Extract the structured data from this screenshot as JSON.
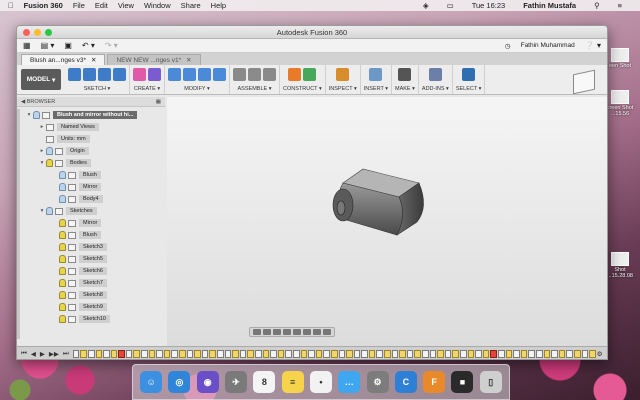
{
  "menubar": {
    "app": "Fusion 360",
    "items": [
      "File",
      "Edit",
      "View",
      "Window",
      "Share",
      "Help"
    ],
    "clock": "Tue 16:23",
    "user": "Fathin Mustafa"
  },
  "window": {
    "title": "Autodesk Fusion 360",
    "user": "Fathin Muhammad",
    "tabs": [
      "Blush an...nges v3*",
      "NEW NEW ...nges v1*"
    ]
  },
  "toolbar": {
    "workspace": "MODEL",
    "groups": [
      {
        "label": "SKETCH ▾",
        "colors": [
          "#3f7cc8",
          "#3f7cc8",
          "#3f7cc8",
          "#3f7cc8"
        ]
      },
      {
        "label": "CREATE ▾",
        "colors": [
          "#e05aa8",
          "#7c5bd0"
        ]
      },
      {
        "label": "MODIFY ▾",
        "colors": [
          "#4a8ad8",
          "#4a8ad8",
          "#4a8ad8",
          "#4a8ad8"
        ]
      },
      {
        "label": "ASSEMBLE ▾",
        "colors": [
          "#8a8a8a",
          "#8a8a8a",
          "#8a8a8a"
        ]
      },
      {
        "label": "CONSTRUCT ▾",
        "colors": [
          "#e87a2a",
          "#48a85a"
        ]
      },
      {
        "label": "INSPECT ▾",
        "colors": [
          "#d98c2c"
        ]
      },
      {
        "label": "INSERT ▾",
        "colors": [
          "#6b98c6"
        ]
      },
      {
        "label": "MAKE ▾",
        "colors": [
          "#555555"
        ]
      },
      {
        "label": "ADD-INS ▾",
        "colors": [
          "#6b7fa8"
        ]
      },
      {
        "label": "SELECT ▾",
        "colors": [
          "#2f6fb0"
        ]
      }
    ]
  },
  "browser": {
    "header": "BROWSER",
    "items": [
      {
        "label": "Blush and mirror without hi...",
        "indent": 0,
        "bulb": "blue",
        "tri": "▾",
        "top": true
      },
      {
        "label": "Named Views",
        "indent": 1,
        "bulb": "",
        "tri": "▸"
      },
      {
        "label": "Units: mm",
        "indent": 1,
        "bulb": "",
        "tri": ""
      },
      {
        "label": "Origin",
        "indent": 1,
        "bulb": "blue",
        "tri": "▸"
      },
      {
        "label": "Bodies",
        "indent": 1,
        "bulb": "yellow",
        "tri": "▾"
      },
      {
        "label": "Blush",
        "indent": 2,
        "bulb": "blue",
        "tri": ""
      },
      {
        "label": "Mirror",
        "indent": 2,
        "bulb": "blue",
        "tri": ""
      },
      {
        "label": "Body4",
        "indent": 2,
        "bulb": "blue",
        "tri": ""
      },
      {
        "label": "Sketches",
        "indent": 1,
        "bulb": "blue",
        "tri": "▾"
      },
      {
        "label": "Mirror",
        "indent": 2,
        "bulb": "yellow",
        "tri": ""
      },
      {
        "label": "Blush",
        "indent": 2,
        "bulb": "yellow",
        "tri": ""
      },
      {
        "label": "Sketch3",
        "indent": 2,
        "bulb": "yellow",
        "tri": ""
      },
      {
        "label": "Sketch5",
        "indent": 2,
        "bulb": "yellow",
        "tri": ""
      },
      {
        "label": "Sketch6",
        "indent": 2,
        "bulb": "yellow",
        "tri": ""
      },
      {
        "label": "Sketch7",
        "indent": 2,
        "bulb": "yellow",
        "tri": ""
      },
      {
        "label": "Sketch8",
        "indent": 2,
        "bulb": "yellow",
        "tri": ""
      },
      {
        "label": "Sketch9",
        "indent": 2,
        "bulb": "yellow",
        "tri": ""
      },
      {
        "label": "Sketch10",
        "indent": 2,
        "bulb": "yellow",
        "tri": ""
      }
    ]
  },
  "timeline": {
    "controls": [
      "⏮",
      "◀",
      "▶",
      "▶▶",
      "⏭"
    ],
    "items": "sysysyrsysysysysysyssysysysyssysysysyssysysysyssysysysyrsysyssysysysy"
  },
  "desktop": {
    "icons": [
      {
        "label": "een Shot"
      },
      {
        "label": "creen Shot ...15.56"
      },
      {
        "label": "Shot ...15.28.08"
      }
    ]
  },
  "dock": {
    "apps": [
      {
        "name": "finder",
        "glyph": "☺",
        "color": "#3d8fe0"
      },
      {
        "name": "safari",
        "glyph": "◎",
        "color": "#2f86d8"
      },
      {
        "name": "siri",
        "glyph": "◉",
        "color": "#6a4fc8"
      },
      {
        "name": "launchpad",
        "glyph": "✈",
        "color": "#7a7a7a"
      },
      {
        "name": "calendar",
        "glyph": "8",
        "color": "#f4f4f4"
      },
      {
        "name": "notes",
        "glyph": "≡",
        "color": "#f6d34a"
      },
      {
        "name": "reminders",
        "glyph": "•",
        "color": "#f2f2f2"
      },
      {
        "name": "messages",
        "glyph": "…",
        "color": "#3fa6f0"
      },
      {
        "name": "system-preferences",
        "glyph": "⚙",
        "color": "#7c7c7c"
      },
      {
        "name": "fusion-c",
        "glyph": "C",
        "color": "#2e7fd6"
      },
      {
        "name": "fusion-360",
        "glyph": "F",
        "color": "#e88a2a"
      },
      {
        "name": "photo",
        "glyph": "■",
        "color": "#2a2a2a"
      },
      {
        "name": "trash",
        "glyph": "▯",
        "color": "#cfcfcf"
      }
    ]
  }
}
